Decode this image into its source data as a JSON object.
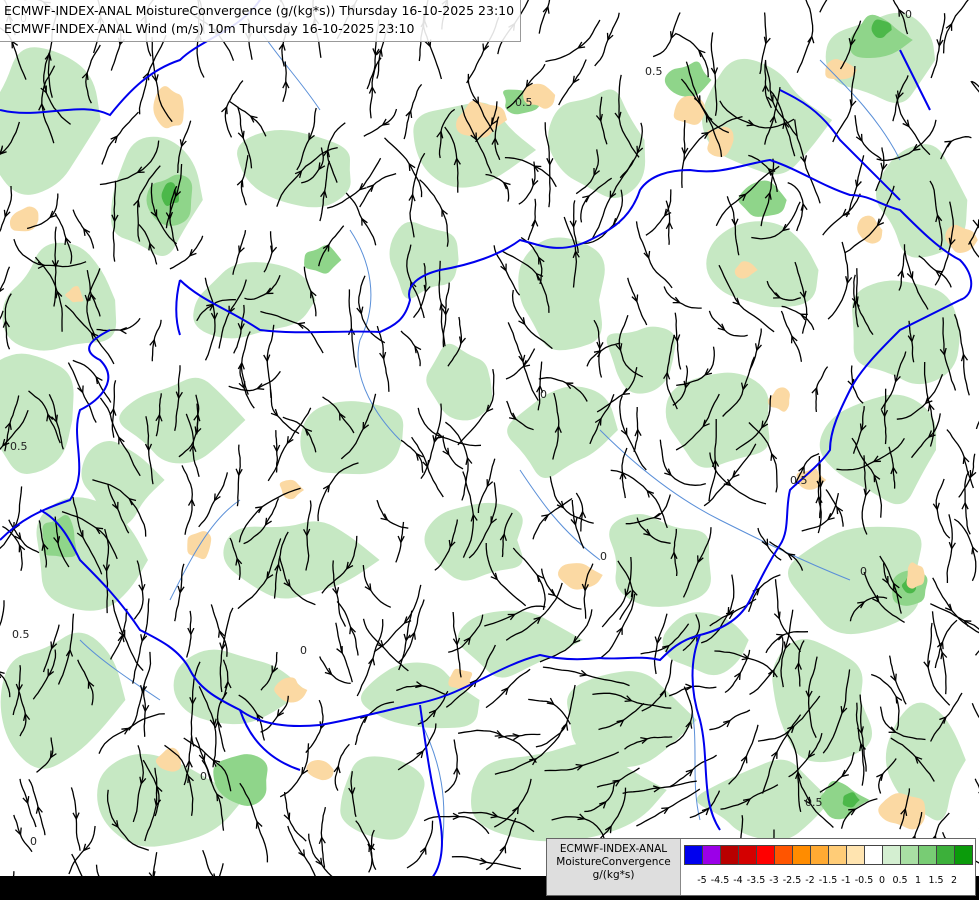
{
  "header": {
    "line1": "ECMWF-INDEX-ANAL MoistureConvergence (g/(kg*s)) Thursday 16-10-2025 23:10",
    "line2": "ECMWF-INDEX-ANAL Wind (m/s) 10m Thursday 16-10-2025 23:10"
  },
  "legend": {
    "title1": "ECMWF-INDEX-ANAL",
    "title2": "MoistureConvergence",
    "title3": "g/(kg*s)",
    "colors": [
      "#0000ee",
      "#9b00e8",
      "#b80000",
      "#d40000",
      "#ff0000",
      "#ff5500",
      "#ff8c00",
      "#ffaa33",
      "#ffcc77",
      "#ffe4b0",
      "#ffffff",
      "#d4efd1",
      "#a9dfa4",
      "#78cc74",
      "#3cb03a",
      "#0b9b0b"
    ],
    "ticks": [
      "-5",
      "-4.5",
      "-4",
      "-3.5",
      "-3",
      "-2.5",
      "-2",
      "-1.5",
      "-1",
      "-0.5",
      "0",
      "0.5",
      "1",
      "1.5",
      "2"
    ]
  },
  "map": {
    "land_color": "#ffffff",
    "green_light": "#c6e8c3",
    "green_mid": "#8fd58a",
    "green_dark": "#4cb84a",
    "orange_light": "#fbd9a3",
    "border_color": "#0000ee",
    "river_color": "#5a8fd8",
    "stream_color": "#000000",
    "contour_labels": [
      "0",
      "0.5",
      "0",
      "0.5",
      "0",
      "0",
      "0.5",
      "0",
      "0.5",
      "0",
      "0.5",
      "0.5",
      "0",
      "0"
    ]
  }
}
